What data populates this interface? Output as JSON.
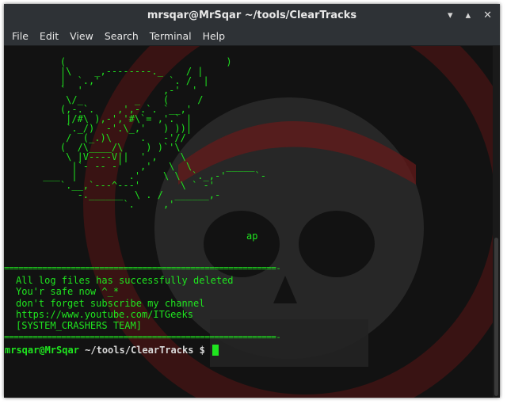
{
  "window": {
    "title": "mrsqar@MrSqar ~/tools/ClearTracks",
    "controls": {
      "minimize": "▾",
      "maximize": "▴",
      "close": "✕"
    }
  },
  "menu": {
    "items": [
      "File",
      "Edit",
      "View",
      "Search",
      "Terminal",
      "Help"
    ]
  },
  "terminal": {
    "ascii_art": "    (                            )\n    |\\    _,--------._    / |\n    |  `.,'            `. /  |\n    `  '              ,-'  '\n     \\/_         _    (     /\n    (,-.`.    ,',-.`. `__,'\n     |/#\\ ),-','#\\`= ,'.` |\n     `._/)  -'.\\_,'   ) ))|\n     /  (_.)\\     .   -'//\n    (  /\\____/\\    ) )`'\\\n     \\ |V----V||  ' ,    \\\n      |`- -- -'   ,'   \\  \\      _____\n ___  |         .'    \\ \\  `._,-'     `-\n    `.__,`---^---'       \\ ` -'\n       -.______  \\ . /  ______,-\n               `.     ,'",
    "ap_text": "ap",
    "separator": "=========================================================-",
    "output_lines": [
      "All log files has successfully deleted",
      "You'r safe now ^_*",
      "don't forget subscribe my channel",
      "https://www.youtube.com/ITGeeks",
      "[SYSTEM_CRASHERS TEAM]"
    ],
    "prompt_user": "mrsqar@MrSqar",
    "prompt_path": " ~/tools/ClearTracks $ "
  }
}
